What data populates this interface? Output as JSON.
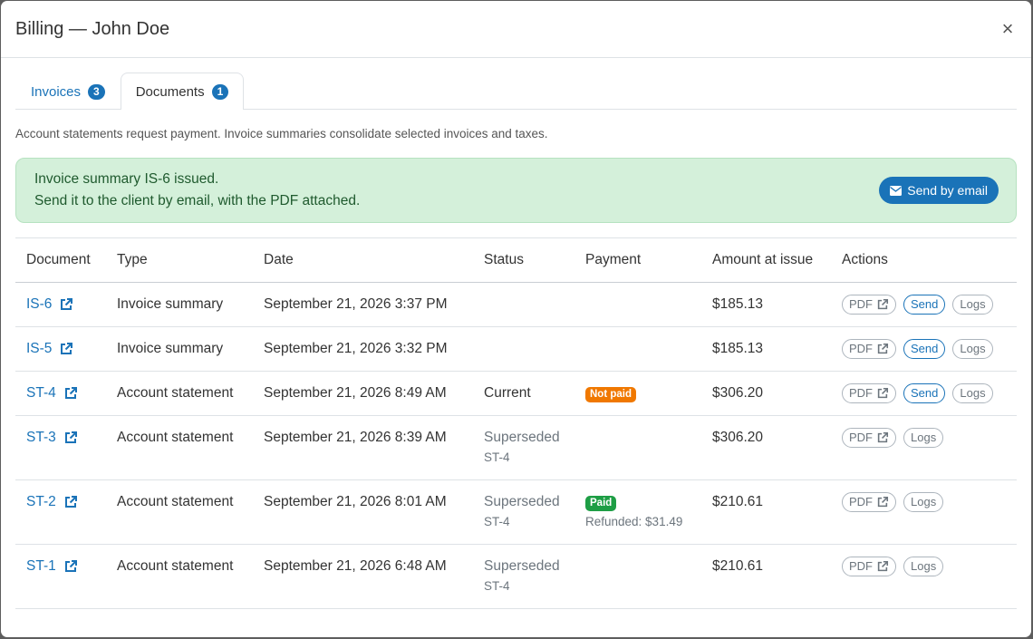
{
  "modal": {
    "title": "Billing — John Doe",
    "close": "×"
  },
  "tabs": [
    {
      "label": "Invoices",
      "count": "3"
    },
    {
      "label": "Documents",
      "count": "1"
    }
  ],
  "description": "Account statements request payment. Invoice summaries consolidate selected invoices and taxes.",
  "alert": {
    "line1": "Invoice summary IS-6 issued.",
    "line2": "Send it to the client by email, with the PDF attached.",
    "button": "Send by email"
  },
  "table": {
    "headers": [
      "Document",
      "Type",
      "Date",
      "Status",
      "Payment",
      "Amount at issue",
      "Actions"
    ],
    "rows": [
      {
        "doc": "IS-6",
        "type": "Invoice summary",
        "date": "September 21, 2026 3:37 PM",
        "status": "",
        "status_sub": "",
        "payment": "",
        "payment_sub": "",
        "amount": "$185.13"
      },
      {
        "doc": "IS-5",
        "type": "Invoice summary",
        "date": "September 21, 2026 3:32 PM",
        "status": "",
        "status_sub": "",
        "payment": "",
        "payment_sub": "",
        "amount": "$185.13"
      },
      {
        "doc": "ST-4",
        "type": "Account statement",
        "date": "September 21, 2026 8:49 AM",
        "status": "Current",
        "status_sub": "",
        "payment": "Not paid",
        "payment_sub": "",
        "amount": "$306.20"
      },
      {
        "doc": "ST-3",
        "type": "Account statement",
        "date": "September 21, 2026 8:39 AM",
        "status": "Superseded",
        "status_sub": "ST-4",
        "payment": "",
        "payment_sub": "",
        "amount": "$306.20"
      },
      {
        "doc": "ST-2",
        "type": "Account statement",
        "date": "September 21, 2026 8:01 AM",
        "status": "Superseded",
        "status_sub": "ST-4",
        "payment": "Paid",
        "payment_sub": "Refunded: $31.49",
        "amount": "$210.61"
      },
      {
        "doc": "ST-1",
        "type": "Account statement",
        "date": "September 21, 2026 6:48 AM",
        "status": "Superseded",
        "status_sub": "ST-4",
        "payment": "",
        "payment_sub": "",
        "amount": "$210.61"
      }
    ],
    "actions": {
      "pdf": "PDF",
      "send": "Send",
      "logs": "Logs"
    }
  },
  "colors": {
    "accent": "#1a73b8",
    "success_bg": "#d4f0da",
    "not_paid": "#f07800",
    "paid": "#1e9e45"
  },
  "icons": {
    "doc_link": "external-link-icon",
    "email": "envelope-icon",
    "close": "close-icon"
  }
}
